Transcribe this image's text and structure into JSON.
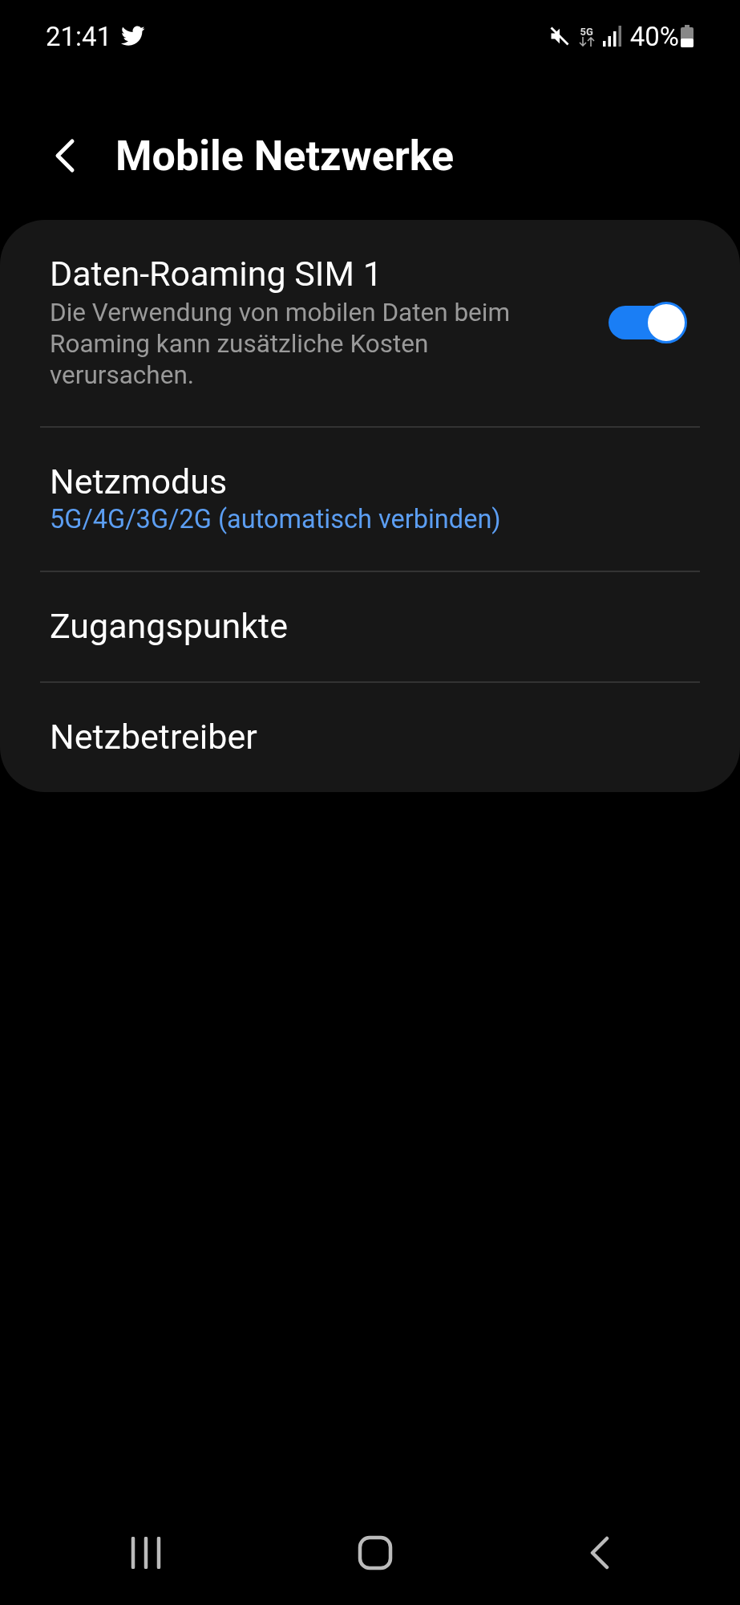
{
  "status_bar": {
    "time": "21:41",
    "network": "5G",
    "battery": "40%"
  },
  "header": {
    "title": "Mobile Netzwerke"
  },
  "settings": [
    {
      "kind": "toggle",
      "title": "Daten-Roaming SIM 1",
      "summary": "Die Verwendung von mobilen Daten beim Roaming kann zusätzliche Kosten verursachen.",
      "on": true
    },
    {
      "kind": "value",
      "title": "Netzmodus",
      "value": "5G/4G/3G/2G (automatisch verbinden)"
    },
    {
      "kind": "link",
      "title": "Zugangspunkte"
    },
    {
      "kind": "link",
      "title": "Netzbetreiber"
    }
  ]
}
